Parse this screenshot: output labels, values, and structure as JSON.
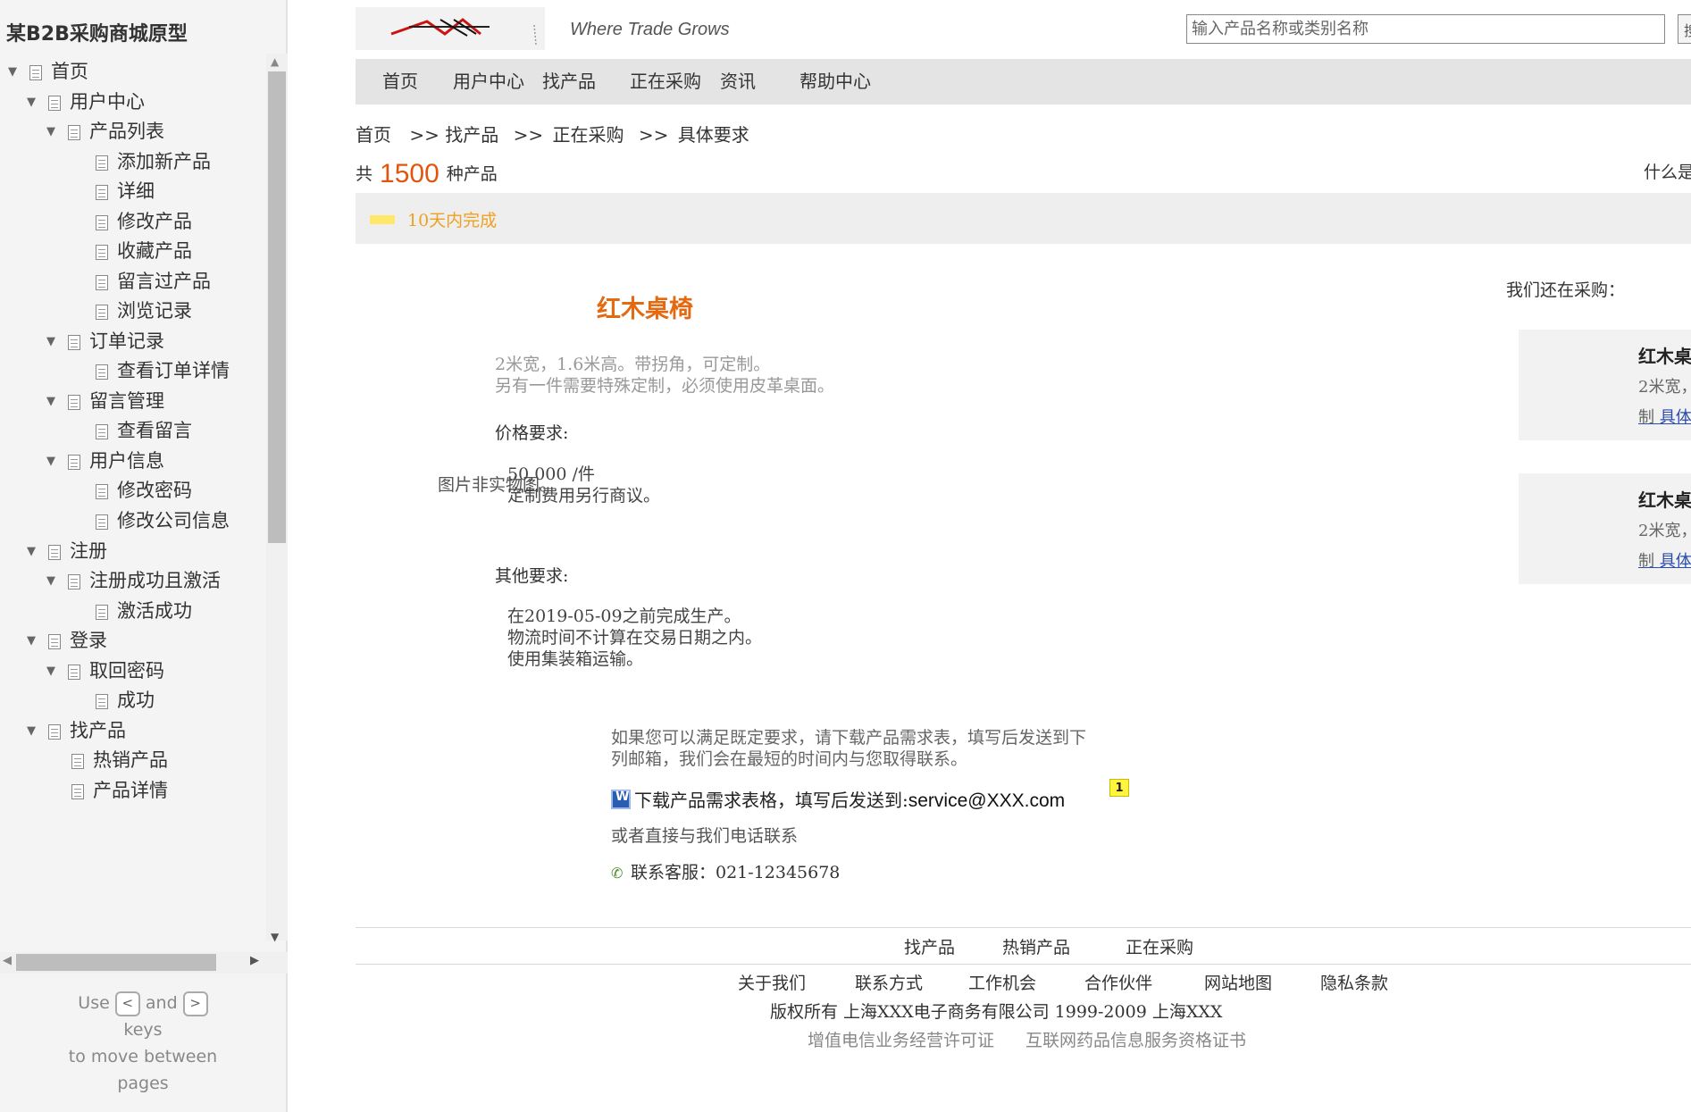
{
  "sidebar": {
    "title": "某B2B采购商城原型",
    "tree": [
      {
        "label": "首页",
        "level": 0,
        "expanded": true
      },
      {
        "label": "用户中心",
        "level": 1,
        "expanded": true
      },
      {
        "label": "产品列表",
        "level": 2,
        "expanded": true
      },
      {
        "label": "添加新产品",
        "level": 3
      },
      {
        "label": "详细",
        "level": 3
      },
      {
        "label": "修改产品",
        "level": 3
      },
      {
        "label": "收藏产品",
        "level": 3
      },
      {
        "label": "留言过产品",
        "level": 3
      },
      {
        "label": "浏览记录",
        "level": 3
      },
      {
        "label": "订单记录",
        "level": 2,
        "expanded": true
      },
      {
        "label": "查看订单详情",
        "level": 3
      },
      {
        "label": "留言管理",
        "level": 2,
        "expanded": true
      },
      {
        "label": "查看留言",
        "level": 3
      },
      {
        "label": "用户信息",
        "level": 2,
        "expanded": true
      },
      {
        "label": "修改密码",
        "level": 3
      },
      {
        "label": "修改公司信息",
        "level": 3
      },
      {
        "label": "注册",
        "level": 1,
        "expanded": true
      },
      {
        "label": "注册成功且激活",
        "level": 2,
        "expanded": true
      },
      {
        "label": "激活成功",
        "level": 3
      },
      {
        "label": "登录",
        "level": 1,
        "expanded": true
      },
      {
        "label": "取回密码",
        "level": 2,
        "expanded": true
      },
      {
        "label": "成功",
        "level": 3
      },
      {
        "label": "找产品",
        "level": 1,
        "expanded": true
      },
      {
        "label": "热销产品",
        "level": 2
      },
      {
        "label": "产品详情",
        "level": 2
      }
    ],
    "keys_hint": {
      "use": "Use",
      "prev_key": "<",
      "and": "and",
      "next_key": ">",
      "keys": "keys",
      "to_move": "to move between",
      "pages": "pages"
    }
  },
  "header": {
    "tagline": "Where Trade Grows",
    "search_placeholder": "输入产品名称或类别名称",
    "search_button": "搜"
  },
  "nav": [
    "首页",
    "用户中心",
    "找产品",
    "正在采购",
    "资讯",
    "帮助中心"
  ],
  "breadcrumb": [
    "首页",
    ">>",
    "找产品",
    ">>",
    "正在采购",
    ">>",
    "具体要求"
  ],
  "count": {
    "prefix": "共",
    "number": "1500",
    "suffix": "种产品",
    "right_text": "什么是"
  },
  "status": {
    "text": "10天内完成",
    "swatch_color": "#ffe76a",
    "text_color": "#f0a020"
  },
  "product": {
    "image_note": "图片非实物图。",
    "title": "红木桌椅",
    "desc_line1": "2米宽，1.6米高。带拐角，可定制。",
    "desc_line2": "另有一件需要特殊定制，必须使用皮革桌面。",
    "price_label": "价格要求:",
    "price_line1": "50,000 /件",
    "price_line2": "定制费用另行商议。",
    "other_label": "其他要求:",
    "other_line1": "在2019-05-09之前完成生产。",
    "other_line2": "物流时间不计算在交易日期之内。",
    "other_line3": "使用集装箱运输。",
    "contact_line1": "如果您可以满足既定要求，请下载产品需求表，填写后发送到下",
    "contact_line2": "列邮箱，我们会在最短的时间内与您取得联系。",
    "download_text": "下载产品需求表格，填写后发送到:",
    "email": "service@XXX.com",
    "note_badge": "1",
    "or_phone": "或者直接与我们电话联系",
    "phone_label": "联系客服：021-12345678"
  },
  "also": {
    "title": "我们还在采购：",
    "cards": [
      {
        "title": "红木桌",
        "desc": "2米宽，",
        "desc2": "制",
        "link": "具体"
      },
      {
        "title": "红木桌",
        "desc": "2米宽，",
        "desc2": "制",
        "link": "具体"
      }
    ]
  },
  "footer": {
    "row1": [
      "找产品",
      "热销产品",
      "正在采购"
    ],
    "row2": [
      "关于我们",
      "联系方式",
      "工作机会",
      "合作伙伴",
      "网站地图",
      "隐私条款"
    ],
    "copyright": "版权所有 上海XXX电子商务有限公司 1999-2009 上海XXX",
    "license1": "增值电信业务经营许可证",
    "license2": "互联网药品信息服务资格证书"
  },
  "colors": {
    "accent_orange": "#e2550e",
    "title_orange": "#e36a10",
    "link_blue": "#2a4bb0"
  }
}
